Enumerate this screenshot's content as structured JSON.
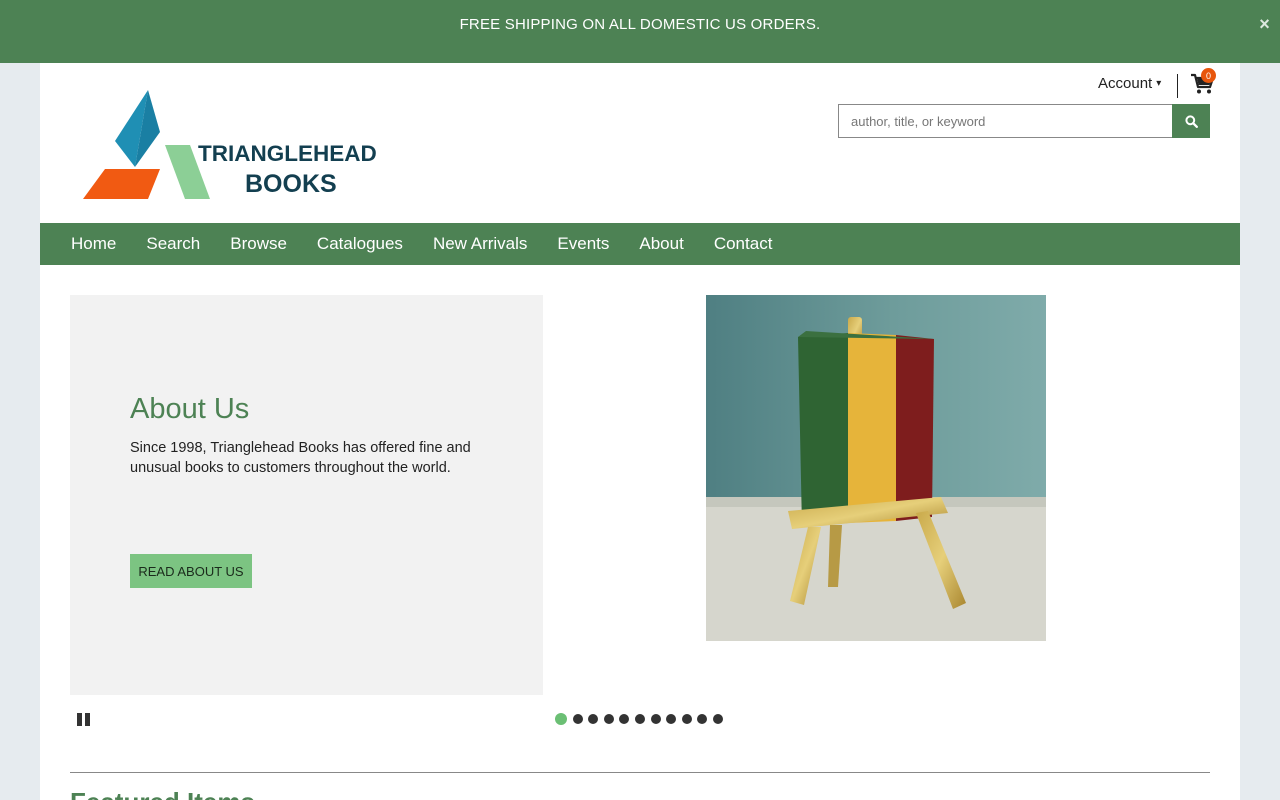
{
  "promo": {
    "text": "FREE SHIPPING ON ALL DOMESTIC US ORDERS.",
    "close_icon": "×"
  },
  "header": {
    "logo": {
      "line1": "TRIANGLEHEAD",
      "line2": "BOOKS"
    },
    "account_label": "Account",
    "account_caret": "▾",
    "cart_count": "0",
    "search": {
      "placeholder": "author, title, or keyword"
    }
  },
  "nav": {
    "items": [
      "Home",
      "Search",
      "Browse",
      "Catalogues",
      "New Arrivals",
      "Events",
      "About",
      "Contact"
    ]
  },
  "slide": {
    "title": "About Us",
    "text": "Since 1998, Trianglehead Books has offered fine and unusual books to customers throughout the world.",
    "button_label": "READ ABOUT US",
    "dot_count": 11,
    "active_dot": 0
  },
  "featured": {
    "title": "Featured Items"
  },
  "colors": {
    "brand_green": "#4d8254",
    "button_green": "#7cc482",
    "badge_orange": "#e8560c"
  }
}
